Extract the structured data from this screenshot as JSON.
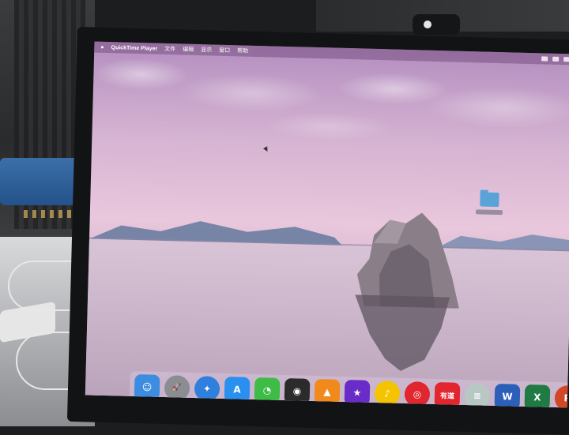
{
  "menubar": {
    "apple_icon": "apple-icon",
    "app_name": "QuickTime Player",
    "items": [
      "文件",
      "编辑",
      "显示",
      "窗口",
      "帮助"
    ]
  },
  "desktop": {
    "folder_icon": "folder-icon"
  },
  "dock": {
    "icons": [
      {
        "name": "finder-icon",
        "color": "#3c8de0",
        "glyph": "☺"
      },
      {
        "name": "launchpad-icon",
        "color": "#8a8d92",
        "glyph": "🚀"
      },
      {
        "name": "safari-icon",
        "color": "#2f7fdc",
        "glyph": "✦"
      },
      {
        "name": "app-store-icon",
        "color": "#2a90f0",
        "glyph": "A"
      },
      {
        "name": "wechat-icon",
        "color": "#3dbd45",
        "glyph": "◔"
      },
      {
        "name": "quicktime-icon",
        "color": "#2b2b2b",
        "glyph": "◉"
      },
      {
        "name": "vlc-icon",
        "color": "#f08a1c",
        "glyph": "▲"
      },
      {
        "name": "imovie-icon",
        "color": "#6a2cc8",
        "glyph": "★"
      },
      {
        "name": "qq-music-icon",
        "color": "#f5c400",
        "glyph": "♪"
      },
      {
        "name": "netease-music-icon",
        "color": "#e0262e",
        "glyph": "◎"
      },
      {
        "name": "youdao-icon",
        "color": "#e3252d",
        "glyph": "有道"
      },
      {
        "name": "disk-icon",
        "color": "#b7c8c4",
        "glyph": "≡"
      },
      {
        "name": "word-icon",
        "color": "#2b5fb8",
        "glyph": "W"
      },
      {
        "name": "excel-icon",
        "color": "#1f7a43",
        "glyph": "X"
      },
      {
        "name": "powerpoint-icon",
        "color": "#d24726",
        "glyph": "P"
      },
      {
        "name": "instruments-icon",
        "color": "#3e4a55",
        "glyph": "⌖"
      }
    ]
  }
}
